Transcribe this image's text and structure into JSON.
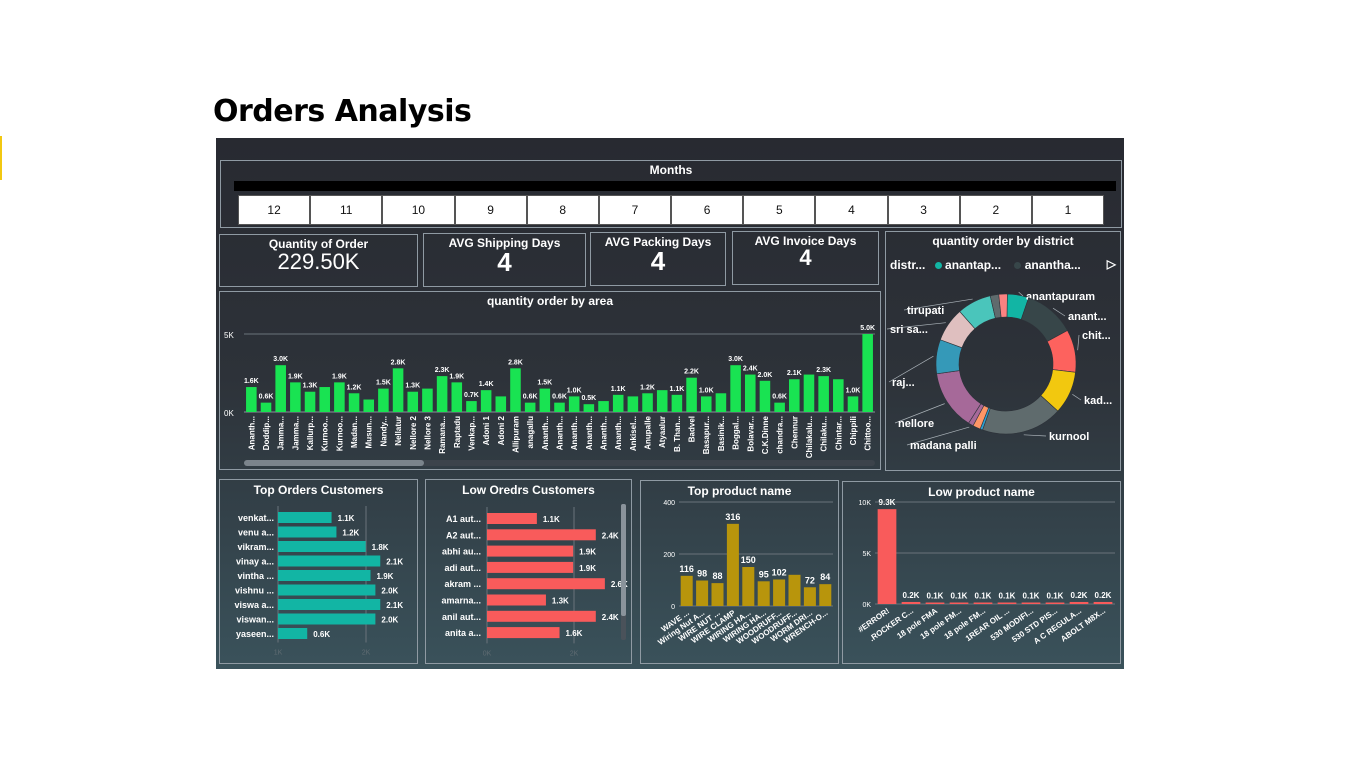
{
  "page": {
    "title": "Orders Analysis"
  },
  "slicer": {
    "title": "Months",
    "months": [
      "12",
      "11",
      "10",
      "9",
      "8",
      "7",
      "6",
      "5",
      "4",
      "3",
      "2",
      "1"
    ]
  },
  "kpis": [
    {
      "label": "Quantity of  Order",
      "value": "229.50K"
    },
    {
      "label": "AVG Shipping Days",
      "value": "4"
    },
    {
      "label": "AVG Packing Days",
      "value": "4"
    },
    {
      "label": "AVG Invoice Days",
      "value": "4"
    }
  ],
  "colors": {
    "area": "#19e352",
    "customers": "#12b5a4",
    "low_customers": "#f95b5b",
    "top_product": "#b8950c",
    "low_product": "#f95b5b"
  },
  "chart_data": [
    {
      "type": "bar",
      "title": "quantity order by area",
      "ylim": [
        0,
        5000
      ],
      "yticks": [
        "0K",
        "5K"
      ],
      "categories": [
        "Ananth...",
        "Doddip...",
        "Jamma...",
        "Jamma...",
        "Kallurp...",
        "Kurnoo...",
        "Kurnoo...",
        "Madan...",
        "Musun...",
        "Nandy...",
        "Nellatur",
        "Nellore 2",
        "Nellore 3",
        "Ramana...",
        "Raptadu",
        "Venkap...",
        "Adoni 1",
        "Adoni 2",
        "Allipuram",
        "anagallu",
        "Ananth...",
        "Ananth...",
        "Ananth...",
        "Ananth...",
        "Ananth...",
        "Ananth...",
        "Ankisel...",
        "Anupalle",
        "Atyaalur",
        "B. Than...",
        "Badvel",
        "Basapur...",
        "Basinik...",
        "Boggal...",
        "Bolavar...",
        "C.K.Dinne",
        "chandra...",
        "Chennur",
        "Chilakalu...",
        "Chilaku...",
        "Chintar...",
        "Chippili",
        "Chittoo..."
      ],
      "values": [
        1600,
        600,
        3000,
        1900,
        1300,
        1600,
        1900,
        1200,
        800,
        1500,
        2800,
        1300,
        1500,
        2300,
        1900,
        700,
        1400,
        1000,
        2800,
        600,
        1500,
        600,
        1000,
        500,
        700,
        1100,
        1000,
        1200,
        1400,
        1100,
        2200,
        1000,
        1200,
        3000,
        2400,
        2000,
        600,
        2100,
        2400,
        2300,
        2100,
        1000,
        5000
      ],
      "labels": [
        "1.6K",
        "0.6K",
        "3.0K",
        "1.9K",
        "1.3K",
        "",
        "1.9K",
        "1.2K",
        "",
        "1.5K",
        "2.8K",
        "1.3K",
        "",
        "2.3K",
        "1.9K",
        "0.7K",
        "1.4K",
        "",
        "2.8K",
        "0.6K",
        "1.5K",
        "0.6K",
        "1.0K",
        "0.5K",
        "",
        "1.1K",
        "",
        "1.2K",
        "",
        "1.1K",
        "2.2K",
        "1.0K",
        "",
        "3.0K",
        "2.4K",
        "2.0K",
        "0.6K",
        "2.1K",
        "",
        "2.3K",
        "",
        "1.0K",
        "5.0K"
      ]
    },
    {
      "type": "pie",
      "title": "quantity order by district",
      "legend_title": "distr...",
      "legend": [
        "anantap...",
        "anantha..."
      ],
      "slices": [
        {
          "name": "anantapuram",
          "value": 5,
          "color": "#12b5a4"
        },
        {
          "name": "anant...",
          "value": 12,
          "color": "#374649"
        },
        {
          "name": "chit...",
          "value": 10,
          "color": "#fd625e"
        },
        {
          "name": "kad...",
          "value": 10,
          "color": "#f2c80f"
        },
        {
          "name": "kurnool",
          "value": 19,
          "color": "#5f6b6d"
        },
        {
          "name": "",
          "value": 0.6,
          "color": "#2d9fd0"
        },
        {
          "name": "",
          "value": 1.8,
          "color": "#fe9666"
        },
        {
          "name": "madana palli",
          "value": 1.2,
          "color": "#a66999"
        },
        {
          "name": "nellore",
          "value": 14,
          "color": "#a66999"
        },
        {
          "name": "raj...",
          "value": 8,
          "color": "#3599b8"
        },
        {
          "name": "sri sa...",
          "value": 8,
          "color": "#dfbfbf"
        },
        {
          "name": "tirupati",
          "value": 8,
          "color": "#4ac5bb"
        },
        {
          "name": "",
          "value": 2,
          "color": "#5f6b6d"
        },
        {
          "name": "",
          "value": 2,
          "color": "#fb8281"
        }
      ]
    },
    {
      "type": "bar",
      "orientation": "horizontal",
      "title": "Top Orders  Customers",
      "xlim": [
        0,
        2300
      ],
      "xticks": [
        "1K",
        "2K"
      ],
      "categories": [
        "venkat...",
        "venu a...",
        "vikram...",
        "vinay a...",
        "vintha ...",
        "vishnu ...",
        "viswa a...",
        "viswan...",
        "yaseen..."
      ],
      "values": [
        1100,
        1200,
        1800,
        2100,
        1900,
        2000,
        2100,
        2000,
        600
      ],
      "labels": [
        "1.1K",
        "1.2K",
        "1.8K",
        "2.1K",
        "1.9K",
        "2.0K",
        "2.1K",
        "2.0K",
        "0.6K"
      ]
    },
    {
      "type": "bar",
      "orientation": "horizontal",
      "title": "Low Oredrs Customers",
      "xlim": [
        0,
        3000
      ],
      "xticks": [
        "0K",
        "2K"
      ],
      "categories": [
        "A1 aut...",
        "A2 aut...",
        "abhi au...",
        "adi aut...",
        "akram ...",
        "amarna...",
        "anil aut...",
        "anita a..."
      ],
      "values": [
        1100,
        2400,
        1900,
        1900,
        2600,
        1300,
        2400,
        1600
      ],
      "labels": [
        "1.1K",
        "2.4K",
        "1.9K",
        "1.9K",
        "2.6K",
        "1.3K",
        "2.4K",
        "1.6K"
      ]
    },
    {
      "type": "bar",
      "title": "Top product name",
      "ylim": [
        0,
        400
      ],
      "yticks": [
        "0",
        "200",
        "400"
      ],
      "categories": [
        "WAVE ...",
        "Wiring Nut A...",
        "WIRE NUT ...",
        "WIRE CLAMP",
        "WIRING HA...",
        "WIRING HA...",
        "WOODRUFF...",
        "WOODRUFF...",
        "WORM DRI...",
        "WRENCH-O..."
      ],
      "values": [
        116,
        98,
        88,
        316,
        150,
        95,
        102,
        120,
        72,
        84
      ],
      "labels": [
        "116",
        "98",
        "88",
        "316",
        "150",
        "95",
        "102",
        "",
        "72",
        "84"
      ]
    },
    {
      "type": "bar",
      "title": "Low product name",
      "ylim": [
        0,
        10000
      ],
      "yticks": [
        "0K",
        "5K",
        "10K"
      ],
      "categories": [
        "#ERROR!",
        ".ROCKER C...",
        "18 pole FMA",
        "18 pole FM...",
        "18 pole FM...",
        "1REAR OIL ...",
        "530 MODIFI...",
        "530 STD PIS...",
        "A C REGULA...",
        "ABOLT M8X..."
      ],
      "values": [
        9300,
        200,
        100,
        100,
        100,
        100,
        100,
        100,
        200,
        200
      ],
      "labels": [
        "9.3K",
        "0.2K",
        "0.1K",
        "0.1K",
        "0.1K",
        "0.1K",
        "0.1K",
        "0.1K",
        "0.2K",
        "0.2K"
      ]
    }
  ]
}
